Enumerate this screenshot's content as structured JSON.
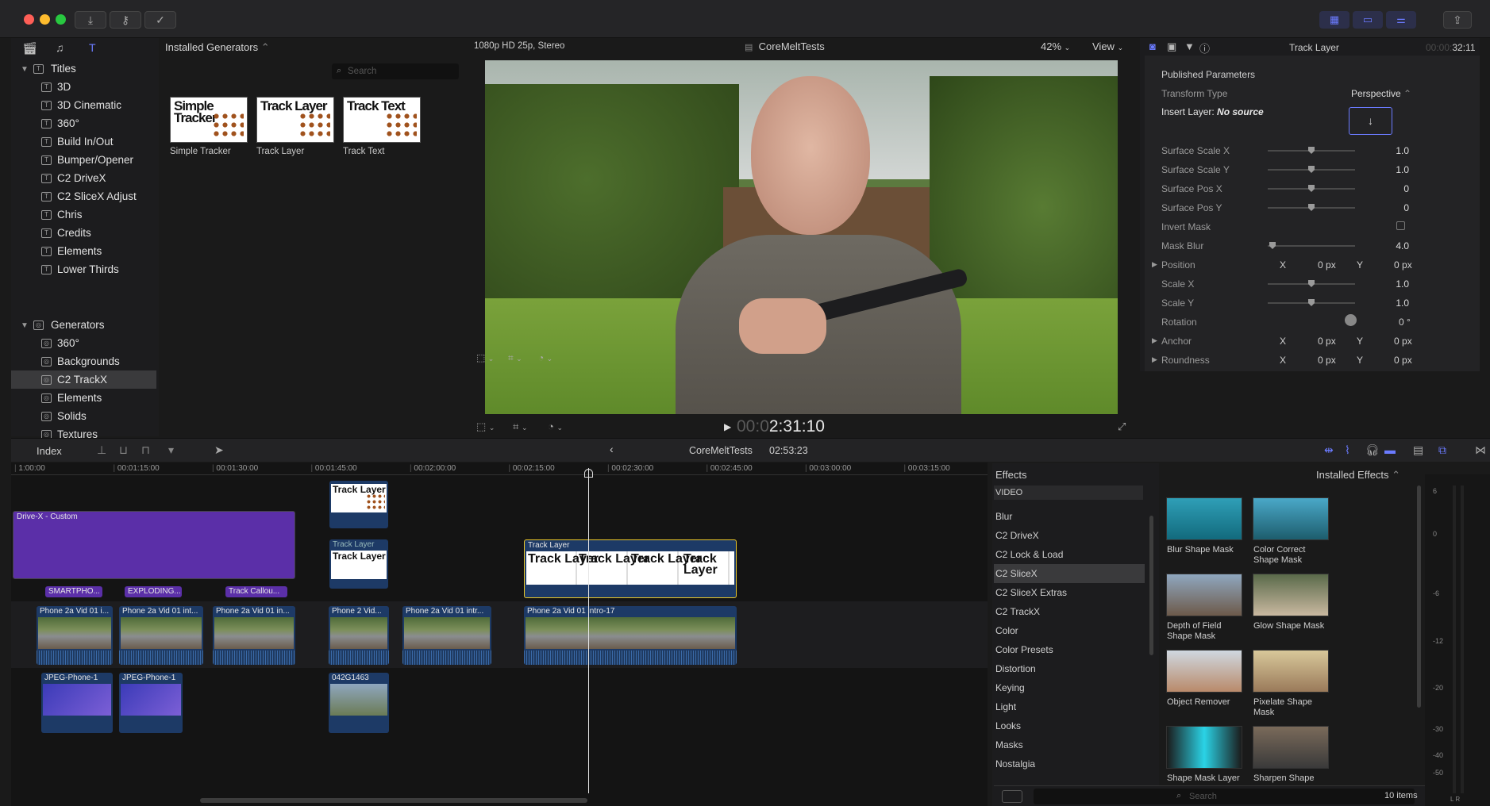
{
  "toolbar": {
    "import_icon": "download-icon",
    "keywords_icon": "key-icon",
    "background_tasks_icon": "checkmark-circle-icon",
    "share_icon": "share-icon"
  },
  "browser": {
    "popup_label": "Installed Generators",
    "search_placeholder": "Search",
    "sidebar": {
      "titles_header": "Titles",
      "titles": [
        "3D",
        "3D Cinematic",
        "360°",
        "Build In/Out",
        "Bumper/Opener",
        "C2 DriveX",
        "C2 SliceX Adjust",
        "Chris",
        "Credits",
        "Elements",
        "Lower Thirds"
      ],
      "generators_header": "Generators",
      "generators": [
        "360°",
        "Backgrounds",
        "C2 TrackX",
        "Elements",
        "Solids",
        "Textures"
      ],
      "selected": "C2 TrackX"
    },
    "items": [
      {
        "thumb_text": "Simple Tracker",
        "label": "Simple Tracker"
      },
      {
        "thumb_text": "Track Layer",
        "label": "Track Layer"
      },
      {
        "thumb_text": "Track Text",
        "label": "Track Text"
      }
    ]
  },
  "viewer": {
    "format": "1080p HD 25p, Stereo",
    "project": "CoreMeltTests",
    "zoom": "42%",
    "view_label": "View",
    "timecode_dim": "00:0",
    "timecode": "2:31:10"
  },
  "inspector": {
    "title": "Track Layer",
    "duration_dim": "00:00:",
    "duration": "32:11",
    "section": "Published Parameters",
    "transform_type_label": "Transform Type",
    "transform_type_value": "Perspective",
    "insert_layer_label": "Insert Layer:",
    "insert_layer_value": "No source",
    "params": [
      {
        "label": "Surface Scale X",
        "value": "1.0",
        "level": 0.5
      },
      {
        "label": "Surface Scale Y",
        "value": "1.0",
        "level": 0.5
      },
      {
        "label": "Surface Pos X",
        "value": "0",
        "level": 0.5
      },
      {
        "label": "Surface Pos Y",
        "value": "0",
        "level": 0.5
      }
    ],
    "invert_mask_label": "Invert Mask",
    "mask_blur_label": "Mask Blur",
    "mask_blur_value": "4.0",
    "position_label": "Position",
    "position_x": "0",
    "position_y": "0",
    "scale_x_label": "Scale X",
    "scale_x_value": "1.0",
    "scale_y_label": "Scale Y",
    "scale_y_value": "1.0",
    "rotation_label": "Rotation",
    "rotation_value": "0",
    "rotation_unit": "°",
    "anchor_label": "Anchor",
    "anchor_x": "0",
    "anchor_y": "0",
    "roundness_label": "Roundness",
    "roundness_x": "0",
    "roundness_y": "0",
    "x_label": "X",
    "y_label": "Y",
    "px_unit": "px"
  },
  "timeline": {
    "index_label": "Index",
    "project": "CoreMeltTests",
    "duration": "02:53:23",
    "ruler": [
      "1:00:00",
      "00:01:15:00",
      "00:01:30:00",
      "00:01:45:00",
      "00:02:00:00",
      "00:02:15:00",
      "00:02:30:00",
      "00:02:45:00",
      "00:03:00:00",
      "00:03:15:00"
    ],
    "clips": {
      "drivex": "Drive-X - Custom",
      "track_layer_small": "Track Layer",
      "track_layer_main": "Track Layer",
      "tag_smartpho": "SMARTPHO...",
      "tag_exploding": "EXPLODING...",
      "tag_track_callout": "Track Callou...",
      "v1": "Phone 2a Vid 01 i...",
      "v2": "Phone 2a Vid 01 int...",
      "v3": "Phone 2a Vid 01 in...",
      "v4": "Phone 2 Vid...",
      "v5": "Phone 2a Vid 01 intr...",
      "v6": "Phone 2a Vid 01 intro-17",
      "jpeg1": "JPEG-Phone-1",
      "jpeg2": "JPEG-Phone-1",
      "still": "042G1463",
      "thumb_text": "Track Layer"
    }
  },
  "effects": {
    "title": "Effects",
    "installed_label": "Installed Effects",
    "category_header": "VIDEO",
    "categories": [
      "Blur",
      "C2 DriveX",
      "C2 Lock & Load",
      "C2 SliceX",
      "C2 SliceX Extras",
      "C2 TrackX",
      "Color",
      "Color Presets",
      "Distortion",
      "Keying",
      "Light",
      "Looks",
      "Masks",
      "Nostalgia"
    ],
    "selected_category": "C2 SliceX",
    "items": [
      "Blur Shape Mask",
      "Color Correct Shape Mask",
      "Depth of Field Shape Mask",
      "Glow Shape Mask",
      "Object Remover",
      "Pixelate Shape Mask",
      "Shape Mask Layer",
      "Sharpen Shape"
    ],
    "search_placeholder": "Search",
    "count": "10 items"
  },
  "meters": {
    "labels": [
      "6",
      "0",
      "-6",
      "-12",
      "-20",
      "-30",
      "-40",
      "-50"
    ],
    "channels": "L  R"
  }
}
